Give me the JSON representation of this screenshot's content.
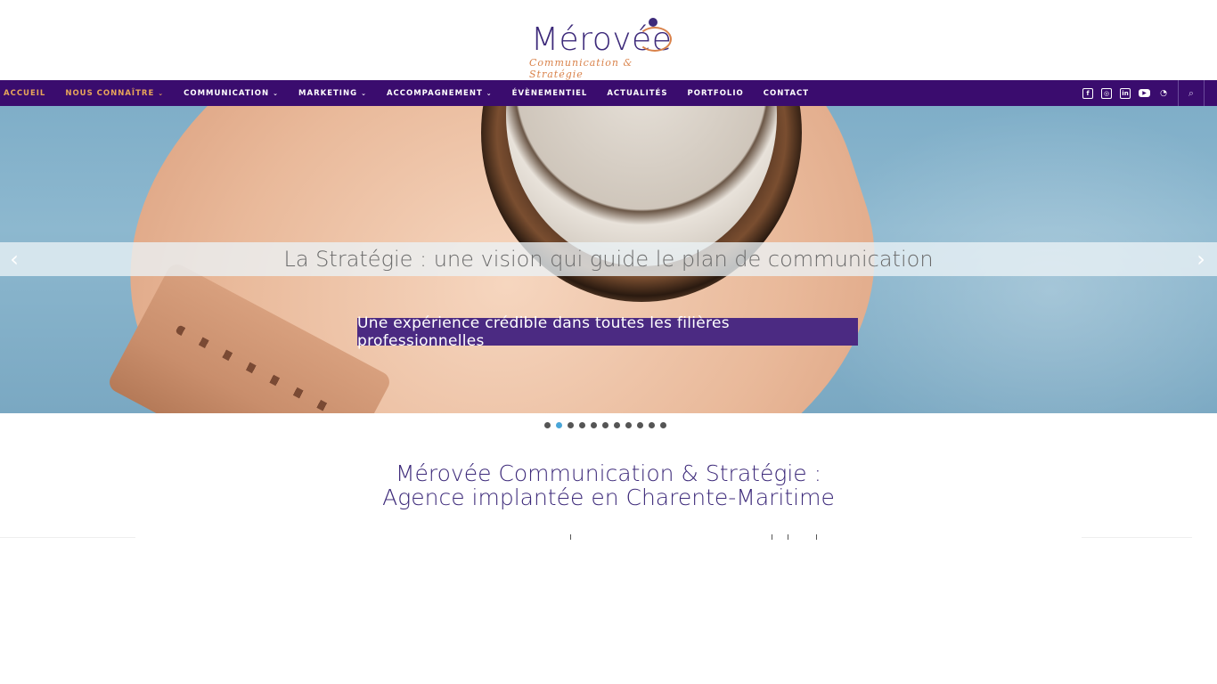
{
  "logo": {
    "name": "Mérovée",
    "tagline": "Communication & Stratégie"
  },
  "nav": {
    "items": [
      {
        "label": "ACCUEIL",
        "active": true,
        "dropdown": false
      },
      {
        "label": "NOUS CONNAÎTRE",
        "active": true,
        "dropdown": true
      },
      {
        "label": "COMMUNICATION",
        "active": false,
        "dropdown": true
      },
      {
        "label": "MARKETING",
        "active": false,
        "dropdown": true
      },
      {
        "label": "ACCOMPAGNEMENT",
        "active": false,
        "dropdown": true
      },
      {
        "label": "ÉVÈNEMENTIEL",
        "active": false,
        "dropdown": false
      },
      {
        "label": "ACTUALITÉS",
        "active": false,
        "dropdown": false
      },
      {
        "label": "PORTFOLIO",
        "active": false,
        "dropdown": false
      },
      {
        "label": "CONTACT",
        "active": false,
        "dropdown": false
      }
    ],
    "chevron": "⌄",
    "social": [
      "facebook-icon",
      "instagram-icon",
      "linkedin-icon",
      "youtube-icon",
      "rss-icon"
    ],
    "search_icon": "search-icon"
  },
  "slider": {
    "title": "La Stratégie : une vision qui guide le plan de communication",
    "subtitle": "Une expérience crédible dans toutes les filières professionnelles",
    "prev_arrow": "‹",
    "next_arrow": "›",
    "slide_count": 11,
    "active_slide": 2
  },
  "intro": {
    "line1": "Mérovée Communication & Stratégie :",
    "line2": "Agence implantée en Charente-Maritime"
  },
  "colors": {
    "brand_purple": "#3a0c6e",
    "accent_orange": "#e8a65a",
    "dot_active": "#4aa6d8"
  }
}
